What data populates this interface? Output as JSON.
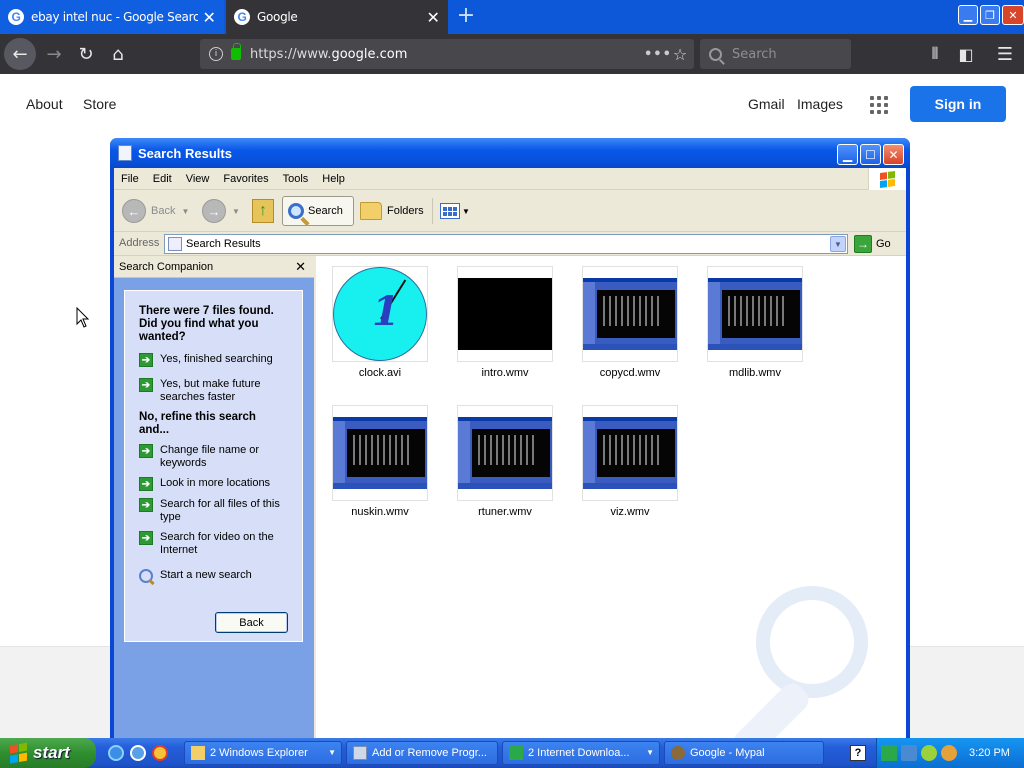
{
  "browser": {
    "tabs": [
      {
        "title": "ebay intel nuc - Google Search",
        "active": false
      },
      {
        "title": "Google",
        "active": true
      }
    ],
    "url_prefix": "https://www.",
    "url_domain": "google.com",
    "search_placeholder": "Search",
    "favicon_letter": "G"
  },
  "google": {
    "about": "About",
    "store": "Store",
    "gmail": "Gmail",
    "images": "Images",
    "signin": "Sign in",
    "accent_color": "#1a73e8"
  },
  "explorer": {
    "title": "Search Results",
    "menu": [
      "File",
      "Edit",
      "View",
      "Favorites",
      "Tools",
      "Help"
    ],
    "toolbar": {
      "back": "Back",
      "search": "Search",
      "folders": "Folders"
    },
    "address_label": "Address",
    "address_value": "Search Results",
    "go": "Go",
    "companion": {
      "header": "Search Companion",
      "question": "There were 7 files found. Did you find what you wanted?",
      "options_a": [
        "Yes, finished searching",
        "Yes, but make future searches faster"
      ],
      "refine": "No, refine this search and...",
      "options_b": [
        "Change file name or keywords",
        "Look in more locations",
        "Search for all files of this type",
        "Search for video on the Internet"
      ],
      "new_search": "Start a new search",
      "back_button": "Back"
    },
    "files": [
      {
        "name": "clock.avi",
        "thumb": "clock"
      },
      {
        "name": "intro.wmv",
        "thumb": "black"
      },
      {
        "name": "copycd.wmv",
        "thumb": "screenshot"
      },
      {
        "name": "mdlib.wmv",
        "thumb": "screenshot"
      },
      {
        "name": "nuskin.wmv",
        "thumb": "screenshot"
      },
      {
        "name": "rtuner.wmv",
        "thumb": "screenshot"
      },
      {
        "name": "viz.wmv",
        "thumb": "screenshot"
      }
    ]
  },
  "taskbar": {
    "start": "start",
    "buttons": [
      "2 Windows Explorer",
      "Add or Remove Progr...",
      "2 Internet Downloa...",
      "Google - Mypal"
    ],
    "clock": "3:20 PM"
  }
}
